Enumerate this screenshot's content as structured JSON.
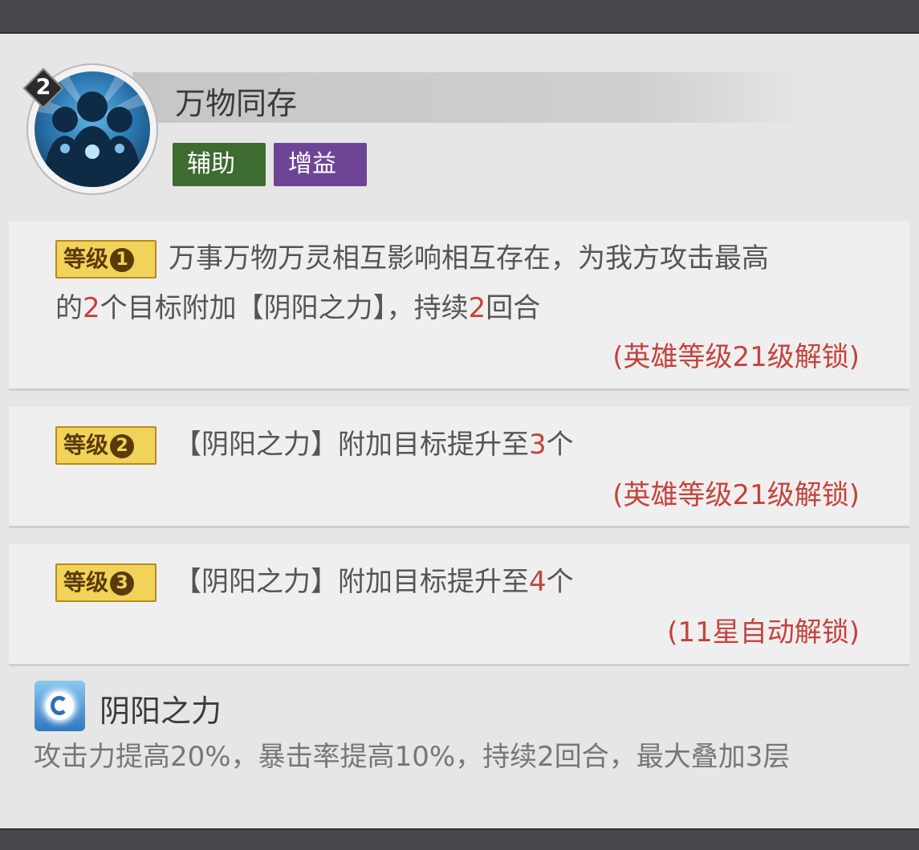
{
  "skill": {
    "rank": "2",
    "name": "万物同存",
    "tags": [
      "辅助",
      "增益"
    ],
    "tag_colors": {
      "support": "#3d6b30",
      "buff": "#6e4596"
    },
    "avatar_icon": "three-figures-yin-yang-icon"
  },
  "levels": [
    {
      "badge_text": "等级",
      "badge_num": "1",
      "desc_line1": "万事万物万灵相互影响相互存在，为我方攻击最高",
      "desc_line2_pre": "的",
      "desc_line2_num1": "2",
      "desc_line2_mid": "个目标附加【阴阳之力】，持续",
      "desc_line2_num2": "2",
      "desc_line2_post": "回合",
      "unlock": "(英雄等级21级解锁)"
    },
    {
      "badge_text": "等级",
      "badge_num": "2",
      "desc_pre": "【阴阳之力】附加目标提升至",
      "desc_num": "3",
      "desc_post": "个",
      "unlock": "(英雄等级21级解锁)"
    },
    {
      "badge_text": "等级",
      "badge_num": "3",
      "desc_pre": "【阴阳之力】附加目标提升至",
      "desc_num": "4",
      "desc_post": "个",
      "unlock": "(11星自动解锁)"
    }
  ],
  "effect": {
    "icon": "yin-yang-power-icon",
    "name": "阴阳之力",
    "description": "攻击力提高20%，暴击率提高10%，持续2回合，最大叠加3层"
  },
  "colors": {
    "highlight_red": "#c4433c",
    "level_badge": "#f2d35a"
  }
}
